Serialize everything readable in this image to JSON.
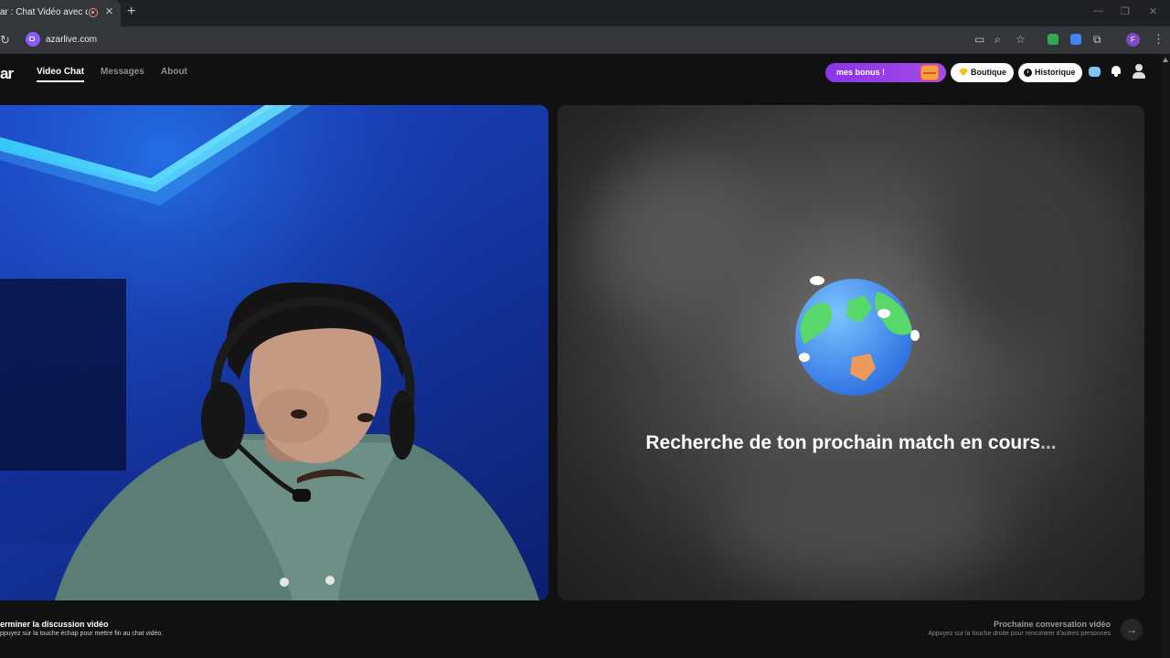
{
  "browser": {
    "tab_title": "ar : Chat Vidéo avec de n",
    "tab_close": "✕",
    "new_tab": "+",
    "url": "azarlive.com",
    "window_controls": [
      "—",
      "❐",
      "✕"
    ],
    "profile_initial": "F",
    "menu": "⋮"
  },
  "header": {
    "logo": "ar",
    "nav": [
      "Video Chat",
      "Messages",
      "About"
    ],
    "active_nav": "Video Chat",
    "bonus_label": "mes bonus !",
    "shop_label": "Boutique",
    "history_label": "Historique"
  },
  "match": {
    "status_text": "Recherche de ton prochain match en cours",
    "status_dots": "..."
  },
  "footer": {
    "end_title": "erminer la discussion vidéo",
    "end_hint": "ppuyez sur la touche échap pour mettre fin au chat vidéo.",
    "next_title": "Prochaine conversation vidéo",
    "next_hint": "Appuyez sur la touche droite pour rencontrer d'autres personnes",
    "next_arrow": "→"
  },
  "colors": {
    "accent_purple": "#8b35e8",
    "background": "#111111",
    "webcam_blue": "#1d46c9"
  }
}
